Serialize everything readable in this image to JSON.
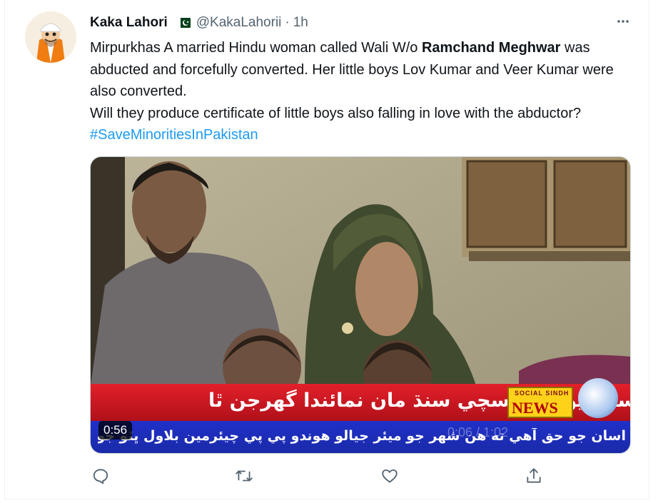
{
  "author": {
    "name": "Kaka Lahori",
    "handle": "@KakaLahorii",
    "separator": "·",
    "time": "1h",
    "verified_flag": "pakistan-flag-icon"
  },
  "tweet": {
    "text_part1": "Mirpurkhas A married Hindu woman called Wali W/o ",
    "text_bold": "Ramchand Meghwar",
    "text_part2": " was abducted and forcefully converted. Her little boys Lov Kumar and Veer Kumar were also converted.",
    "text_line3": "Will they produce certificate of little boys also falling in love with the abductor? ",
    "hashtag": "#SaveMinoritiesInPakistan"
  },
  "media": {
    "type": "video",
    "duration": "0:56",
    "progress_overlay": "0:06 / 1:02",
    "banner_text": "سوشل سنڌ نيوز کي سچي سنڌ مان نمائندا گهرجن ٿا",
    "news_logo_small": "SOCIAL SINDH",
    "news_logo": "NEWS",
    "ticker_text": "اسان جو حق آهي ته هن شهر جو ميئر جيالو هوندو پي پي چيئرمين بلاول ڀٽو جو يوم"
  },
  "actions": {
    "reply_icon": "reply-icon",
    "retweet_icon": "retweet-icon",
    "like_icon": "heart-icon",
    "share_icon": "share-icon"
  },
  "colors": {
    "accent": "#1d9bf0",
    "text": "#0f1419",
    "secondary": "#536471",
    "banner_red": "#d4141e",
    "ticker_blue": "#1f2ebf"
  }
}
